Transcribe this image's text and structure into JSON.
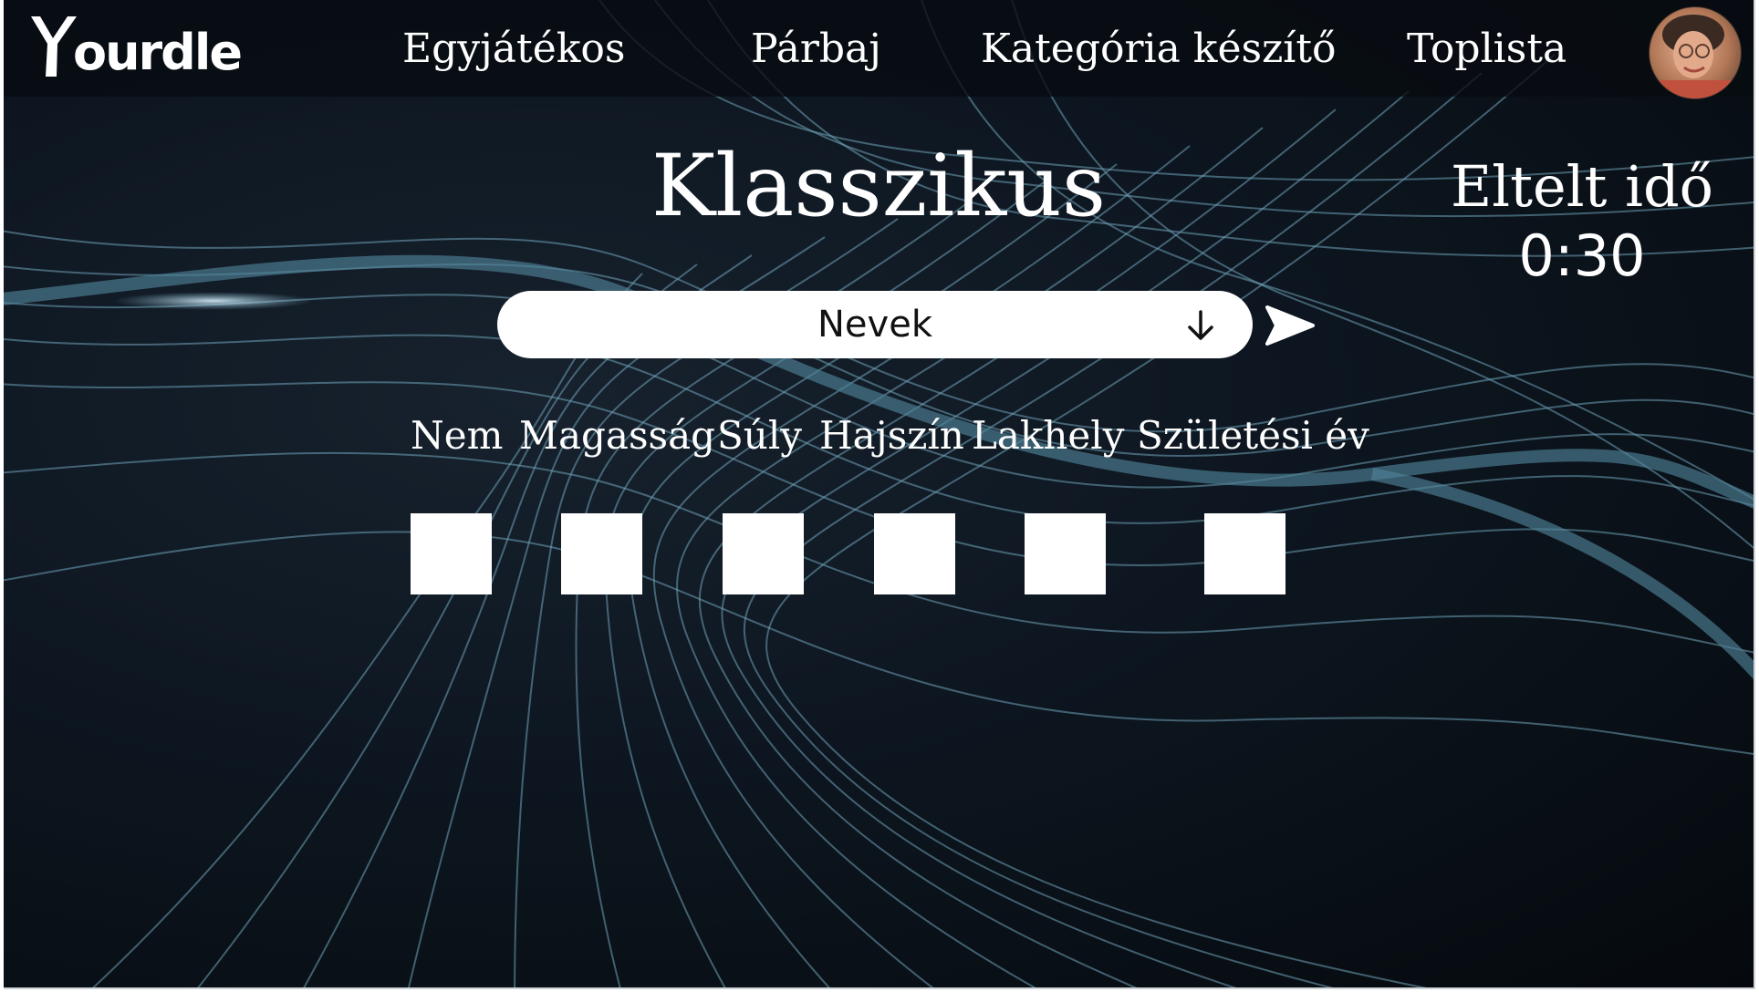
{
  "app": {
    "logo_text": "ourdle"
  },
  "nav": {
    "single_player": "Egyjátékos",
    "duel": "Párbaj",
    "category_creator": "Kategória készítő",
    "leaderboard": "Toplista"
  },
  "game": {
    "title": "Klasszikus",
    "timer_label": "Eltelt idő",
    "timer_value": "0:30",
    "selected_category": "Nevek",
    "columns": [
      "Nem",
      "Magasság",
      "Súly",
      "Hajszín",
      "Lakhely",
      "Születési év"
    ]
  },
  "colors": {
    "background": "#0d1620",
    "wave": "#7fb3c8",
    "accent": "#ffffff"
  },
  "icons": {
    "select": "arrow-down-icon",
    "submit": "send-icon"
  }
}
